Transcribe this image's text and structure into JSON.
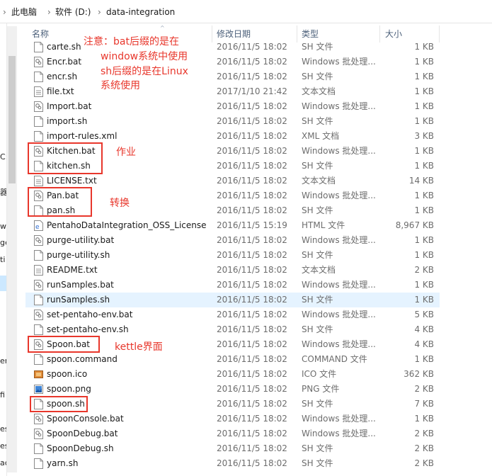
{
  "breadcrumb": [
    {
      "label": "此电脑"
    },
    {
      "label": "软件 (D:)"
    },
    {
      "label": "data-integration"
    }
  ],
  "columns": {
    "name": "名称",
    "date": "修改日期",
    "type": "类型",
    "size": "大小"
  },
  "left_pane_fragments": [
    "C:",
    "器",
    "w",
    "ge",
    "ti",
    "er",
    "fi",
    "es",
    "es",
    "ac"
  ],
  "files": [
    {
      "name": "carte.sh",
      "date": "2016/11/5 18:02",
      "type": "SH 文件",
      "size": "1 KB",
      "icon": "sh"
    },
    {
      "name": "Encr.bat",
      "date": "2016/11/5 18:02",
      "type": "Windows 批处理...",
      "size": "1 KB",
      "icon": "bat"
    },
    {
      "name": "encr.sh",
      "date": "2016/11/5 18:02",
      "type": "SH 文件",
      "size": "1 KB",
      "icon": "sh"
    },
    {
      "name": "file.txt",
      "date": "2017/1/10 21:42",
      "type": "文本文档",
      "size": "1 KB",
      "icon": "txt"
    },
    {
      "name": "Import.bat",
      "date": "2016/11/5 18:02",
      "type": "Windows 批处理...",
      "size": "1 KB",
      "icon": "bat"
    },
    {
      "name": "import.sh",
      "date": "2016/11/5 18:02",
      "type": "SH 文件",
      "size": "1 KB",
      "icon": "sh"
    },
    {
      "name": "import-rules.xml",
      "date": "2016/11/5 18:02",
      "type": "XML 文档",
      "size": "3 KB",
      "icon": "xml"
    },
    {
      "name": "Kitchen.bat",
      "date": "2016/11/5 18:02",
      "type": "Windows 批处理...",
      "size": "1 KB",
      "icon": "bat"
    },
    {
      "name": "kitchen.sh",
      "date": "2016/11/5 18:02",
      "type": "SH 文件",
      "size": "1 KB",
      "icon": "sh"
    },
    {
      "name": "LICENSE.txt",
      "date": "2016/11/5 18:02",
      "type": "文本文档",
      "size": "14 KB",
      "icon": "txt"
    },
    {
      "name": "Pan.bat",
      "date": "2016/11/5 18:02",
      "type": "Windows 批处理...",
      "size": "1 KB",
      "icon": "bat"
    },
    {
      "name": "pan.sh",
      "date": "2016/11/5 18:02",
      "type": "SH 文件",
      "size": "1 KB",
      "icon": "sh"
    },
    {
      "name": "PentahoDataIntegration_OSS_License...",
      "date": "2016/11/5 15:19",
      "type": "HTML 文件",
      "size": "8,967 KB",
      "icon": "html"
    },
    {
      "name": "purge-utility.bat",
      "date": "2016/11/5 18:02",
      "type": "Windows 批处理...",
      "size": "1 KB",
      "icon": "bat"
    },
    {
      "name": "purge-utility.sh",
      "date": "2016/11/5 18:02",
      "type": "SH 文件",
      "size": "1 KB",
      "icon": "sh"
    },
    {
      "name": "README.txt",
      "date": "2016/11/5 18:02",
      "type": "文本文档",
      "size": "2 KB",
      "icon": "txt"
    },
    {
      "name": "runSamples.bat",
      "date": "2016/11/5 18:02",
      "type": "Windows 批处理...",
      "size": "1 KB",
      "icon": "bat"
    },
    {
      "name": "runSamples.sh",
      "date": "2016/11/5 18:02",
      "type": "SH 文件",
      "size": "1 KB",
      "icon": "sh",
      "highlight": true
    },
    {
      "name": "set-pentaho-env.bat",
      "date": "2016/11/5 18:02",
      "type": "Windows 批处理...",
      "size": "5 KB",
      "icon": "bat"
    },
    {
      "name": "set-pentaho-env.sh",
      "date": "2016/11/5 18:02",
      "type": "SH 文件",
      "size": "4 KB",
      "icon": "sh"
    },
    {
      "name": "Spoon.bat",
      "date": "2016/11/5 18:02",
      "type": "Windows 批处理...",
      "size": "4 KB",
      "icon": "bat"
    },
    {
      "name": "spoon.command",
      "date": "2016/11/5 18:02",
      "type": "COMMAND 文件",
      "size": "1 KB",
      "icon": "sh"
    },
    {
      "name": "spoon.ico",
      "date": "2016/11/5 18:02",
      "type": "ICO 文件",
      "size": "362 KB",
      "icon": "ico"
    },
    {
      "name": "spoon.png",
      "date": "2016/11/5 18:02",
      "type": "PNG 文件",
      "size": "2 KB",
      "icon": "png"
    },
    {
      "name": "spoon.sh",
      "date": "2016/11/5 18:02",
      "type": "SH 文件",
      "size": "7 KB",
      "icon": "sh"
    },
    {
      "name": "SpoonConsole.bat",
      "date": "2016/11/5 18:02",
      "type": "Windows 批处理...",
      "size": "1 KB",
      "icon": "bat"
    },
    {
      "name": "SpoonDebug.bat",
      "date": "2016/11/5 18:02",
      "type": "Windows 批处理...",
      "size": "2 KB",
      "icon": "bat"
    },
    {
      "name": "SpoonDebug.sh",
      "date": "2016/11/5 18:02",
      "type": "SH 文件",
      "size": "2 KB",
      "icon": "sh"
    },
    {
      "name": "yarn.sh",
      "date": "2016/11/5 18:02",
      "type": "SH 文件",
      "size": "2 KB",
      "icon": "sh"
    }
  ],
  "annotations": {
    "note_lines": [
      "注意：bat后缀的是在",
      "window系统中使用",
      "sh后缀的是在Linux",
      "系统使用"
    ],
    "kitchen": "作业",
    "pan": "转换",
    "spoon": "kettle界面"
  },
  "colors": {
    "annotation": "#e8372c",
    "header_text": "#4c607a",
    "row_highlight": "#e5f3ff",
    "selection": "#cce8ff"
  }
}
